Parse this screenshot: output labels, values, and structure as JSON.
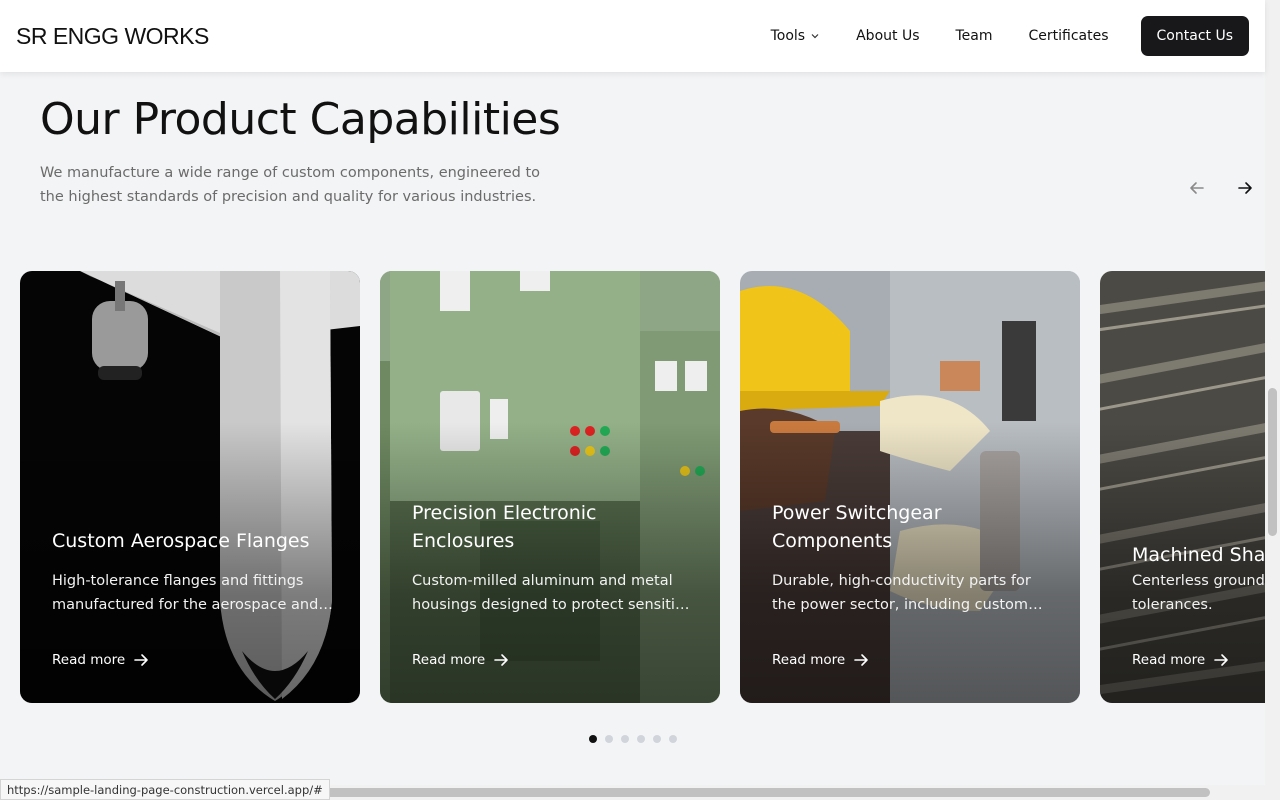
{
  "header": {
    "brand": "SR ENGG WORKS",
    "nav": [
      {
        "label": "Tools",
        "has_dropdown": true
      },
      {
        "label": "About Us"
      },
      {
        "label": "Team"
      },
      {
        "label": "Certificates"
      }
    ],
    "contact_label": "Contact Us"
  },
  "section": {
    "title": "Our Product Capabilities",
    "subtitle": "We manufacture a wide range of custom components, engineered to the highest standards of precision and quality for various industries."
  },
  "cards": [
    {
      "title": "Custom Aerospace Flanges",
      "description": "High-tolerance flanges and fittings manufactured for the aerospace and defense industries.",
      "link": "Read more"
    },
    {
      "title": "Precision Electronic Enclosures",
      "description": "Custom-milled aluminum and metal housings designed to protect sensitive electronics.",
      "link": "Read more"
    },
    {
      "title": "Power Switchgear Components",
      "description": "Durable, high-conductivity parts for the power sector, including custom busbars.",
      "link": "Read more"
    },
    {
      "title": "Machined Shafts",
      "description": "Centerless ground shafts with precise tolerances.",
      "link": "Read more"
    }
  ],
  "carousel": {
    "page_count": 6,
    "active_index": 0
  },
  "status_bar": {
    "url": "https://sample-landing-page-construction.vercel.app/#"
  },
  "colors": {
    "accent": "#18181b",
    "background": "#f3f4f6"
  }
}
